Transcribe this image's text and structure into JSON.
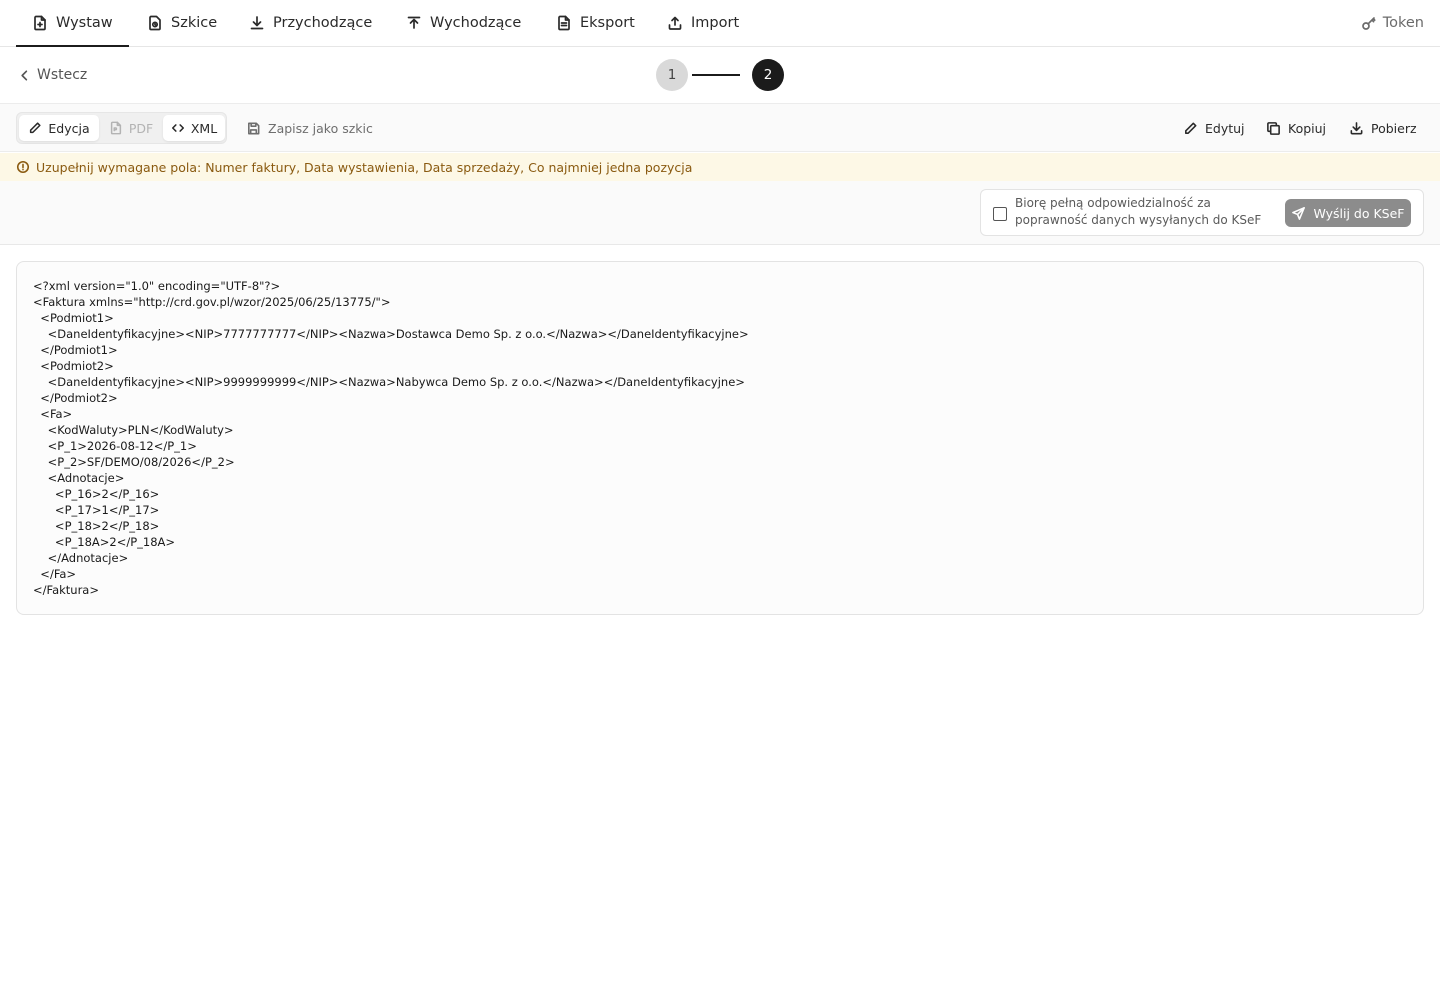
{
  "nav": {
    "tabs": [
      {
        "label": "Wystaw",
        "icon": "file-plus-icon",
        "active": true
      },
      {
        "label": "Szkice",
        "icon": "drafts-icon"
      },
      {
        "label": "Przychodzące",
        "icon": "download-icon"
      },
      {
        "label": "Wychodzące",
        "icon": "upload-icon"
      },
      {
        "label": "Eksport",
        "icon": "file-text-icon"
      },
      {
        "label": "Import",
        "icon": "import-icon"
      }
    ],
    "token_label": "Token"
  },
  "subbar": {
    "back_label": "Wstecz",
    "steps": [
      "1",
      "2"
    ],
    "current_step": 2
  },
  "toolbar": {
    "view_modes": [
      {
        "label": "Edycja",
        "icon": "pencil-icon",
        "state": "selected"
      },
      {
        "label": "PDF",
        "icon": "pdf-file-icon",
        "state": "disabled"
      },
      {
        "label": "XML",
        "icon": "code-icon",
        "state": "active"
      }
    ],
    "save_draft_label": "Zapisz jako szkic",
    "edit_label": "Edytuj",
    "copy_label": "Kopiuj",
    "download_label": "Pobierz"
  },
  "warning": {
    "text": "Uzupełnij wymagane pola: Numer faktury, Data wystawienia, Data sprzedaży, Co najmniej jedna pozycja",
    "color": "#8a5a10",
    "background": "#fdf8e6"
  },
  "send": {
    "checkbox_label": "Biorę pełną odpowiedzialność za poprawność danych wysyłanych do KSeF",
    "checked": false,
    "button_label": "Wyślij do KSeF"
  },
  "xml": {
    "content": "<?xml version=\"1.0\" encoding=\"UTF-8\"?>\n<Faktura xmlns=\"http://crd.gov.pl/wzor/2025/06/25/13775/\">\n  <Podmiot1>\n    <DaneIdentyfikacyjne><NIP>7777777777</NIP><Nazwa>Dostawca Demo Sp. z o.o.</Nazwa></DaneIdentyfikacyjne>\n  </Podmiot1>\n  <Podmiot2>\n    <DaneIdentyfikacyjne><NIP>9999999999</NIP><Nazwa>Nabywca Demo Sp. z o.o.</Nazwa></DaneIdentyfikacyjne>\n  </Podmiot2>\n  <Fa>\n    <KodWaluty>PLN</KodWaluty>\n    <P_1>2026-08-12</P_1>\n    <P_2>SF/DEMO/08/2026</P_2>\n    <Adnotacje>\n      <P_16>2</P_16>\n      <P_17>1</P_17>\n      <P_18>2</P_18>\n      <P_18A>2</P_18A>\n    </Adnotacje>\n  </Fa>\n</Faktura>"
  }
}
